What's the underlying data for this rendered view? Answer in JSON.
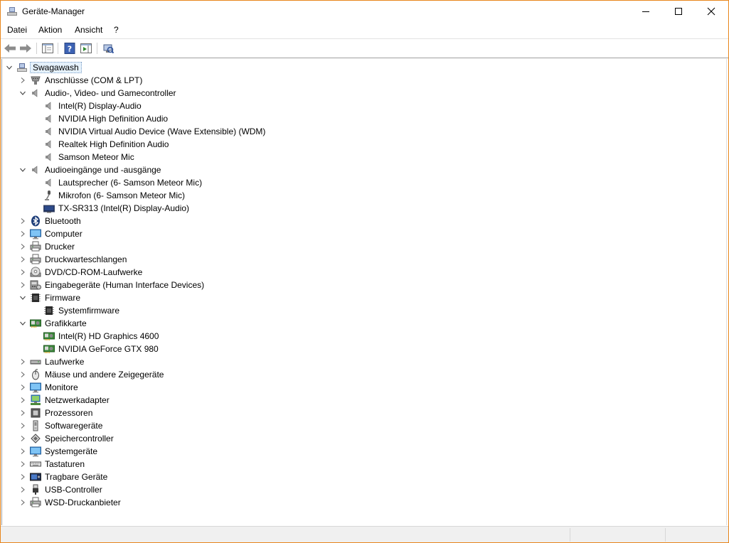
{
  "window": {
    "title": "Geräte-Manager"
  },
  "menu": {
    "items": [
      "Datei",
      "Aktion",
      "Ansicht",
      "?"
    ]
  },
  "tree": {
    "root": {
      "label": "Swagawash",
      "icon": "computer-node-icon"
    },
    "categories": [
      {
        "label": "Anschlüsse (COM & LPT)",
        "icon": "port-icon",
        "expanded": false,
        "children": []
      },
      {
        "label": "Audio-, Video- und Gamecontroller",
        "icon": "speaker-icon",
        "expanded": true,
        "children": [
          {
            "label": "Intel(R) Display-Audio",
            "icon": "speaker-icon"
          },
          {
            "label": "NVIDIA High Definition Audio",
            "icon": "speaker-icon"
          },
          {
            "label": "NVIDIA Virtual Audio Device (Wave Extensible) (WDM)",
            "icon": "speaker-icon"
          },
          {
            "label": "Realtek High Definition Audio",
            "icon": "speaker-icon"
          },
          {
            "label": "Samson Meteor Mic",
            "icon": "speaker-icon"
          }
        ]
      },
      {
        "label": "Audioeingänge und -ausgänge",
        "icon": "speaker-icon",
        "expanded": true,
        "children": [
          {
            "label": "Lautsprecher (6- Samson Meteor Mic)",
            "icon": "speaker-icon"
          },
          {
            "label": "Mikrofon (6- Samson Meteor Mic)",
            "icon": "microphone-icon"
          },
          {
            "label": "TX-SR313 (Intel(R) Display-Audio)",
            "icon": "display-icon"
          }
        ]
      },
      {
        "label": "Bluetooth",
        "icon": "bluetooth-icon",
        "expanded": false,
        "children": []
      },
      {
        "label": "Computer",
        "icon": "monitor-icon",
        "expanded": false,
        "children": []
      },
      {
        "label": "Drucker",
        "icon": "printer-icon",
        "expanded": false,
        "children": []
      },
      {
        "label": "Druckwarteschlangen",
        "icon": "printer-icon",
        "expanded": false,
        "children": []
      },
      {
        "label": "DVD/CD-ROM-Laufwerke",
        "icon": "disc-icon",
        "expanded": false,
        "children": []
      },
      {
        "label": "Eingabegeräte (Human Interface Devices)",
        "icon": "hid-icon",
        "expanded": false,
        "children": []
      },
      {
        "label": "Firmware",
        "icon": "chip-icon",
        "expanded": true,
        "children": [
          {
            "label": "Systemfirmware",
            "icon": "chip-icon"
          }
        ]
      },
      {
        "label": "Grafikkarte",
        "icon": "graphics-card-icon",
        "expanded": true,
        "children": [
          {
            "label": "Intel(R) HD Graphics 4600",
            "icon": "graphics-card-icon"
          },
          {
            "label": "NVIDIA GeForce GTX 980",
            "icon": "graphics-card-icon"
          }
        ]
      },
      {
        "label": "Laufwerke",
        "icon": "drive-icon",
        "expanded": false,
        "children": []
      },
      {
        "label": "Mäuse und andere Zeigegeräte",
        "icon": "mouse-icon",
        "expanded": false,
        "children": []
      },
      {
        "label": "Monitore",
        "icon": "monitor-icon",
        "expanded": false,
        "children": []
      },
      {
        "label": "Netzwerkadapter",
        "icon": "network-icon",
        "expanded": false,
        "children": []
      },
      {
        "label": "Prozessoren",
        "icon": "processor-icon",
        "expanded": false,
        "children": []
      },
      {
        "label": "Softwaregeräte",
        "icon": "software-device-icon",
        "expanded": false,
        "children": []
      },
      {
        "label": "Speichercontroller",
        "icon": "storage-controller-icon",
        "expanded": false,
        "children": []
      },
      {
        "label": "Systemgeräte",
        "icon": "monitor-icon",
        "expanded": false,
        "children": []
      },
      {
        "label": "Tastaturen",
        "icon": "keyboard-icon",
        "expanded": false,
        "children": []
      },
      {
        "label": "Tragbare Geräte",
        "icon": "portable-device-icon",
        "expanded": false,
        "children": []
      },
      {
        "label": "USB-Controller",
        "icon": "usb-icon",
        "expanded": false,
        "children": []
      },
      {
        "label": "WSD-Druckanbieter",
        "icon": "printer-icon",
        "expanded": false,
        "children": []
      }
    ]
  }
}
